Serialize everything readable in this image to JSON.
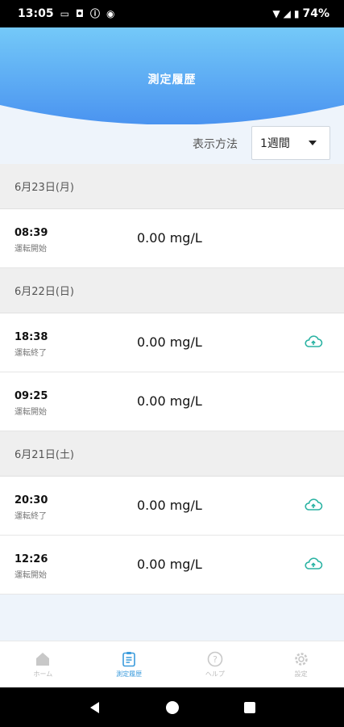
{
  "status_bar": {
    "time": "13:05",
    "battery": "74%"
  },
  "header": {
    "title": "測定履歴"
  },
  "display": {
    "label": "表示方法",
    "selected": "1週間"
  },
  "groups": [
    {
      "date": "6月23日(月)",
      "records": [
        {
          "time": "08:39",
          "status": "運転開始",
          "value": "0.00 mg/L",
          "uploaded": false
        }
      ]
    },
    {
      "date": "6月22日(日)",
      "records": [
        {
          "time": "18:38",
          "status": "運転終了",
          "value": "0.00 mg/L",
          "uploaded": true
        },
        {
          "time": "09:25",
          "status": "運転開始",
          "value": "0.00 mg/L",
          "uploaded": false
        }
      ]
    },
    {
      "date": "6月21日(土)",
      "records": [
        {
          "time": "20:30",
          "status": "運転終了",
          "value": "0.00 mg/L",
          "uploaded": true
        },
        {
          "time": "12:26",
          "status": "運転開始",
          "value": "0.00 mg/L",
          "uploaded": true
        }
      ]
    }
  ],
  "bottom_nav": [
    {
      "label": "ホーム",
      "icon": "home-icon",
      "active": false
    },
    {
      "label": "測定履歴",
      "icon": "clipboard-icon",
      "active": true
    },
    {
      "label": "ヘルプ",
      "icon": "help-icon",
      "active": false
    },
    {
      "label": "設定",
      "icon": "gear-icon",
      "active": false
    }
  ],
  "colors": {
    "accent": "#3a9bdc",
    "upload_icon": "#2bb3a3",
    "header_top": "#6cc3f7",
    "header_bottom": "#3f8ff0"
  }
}
